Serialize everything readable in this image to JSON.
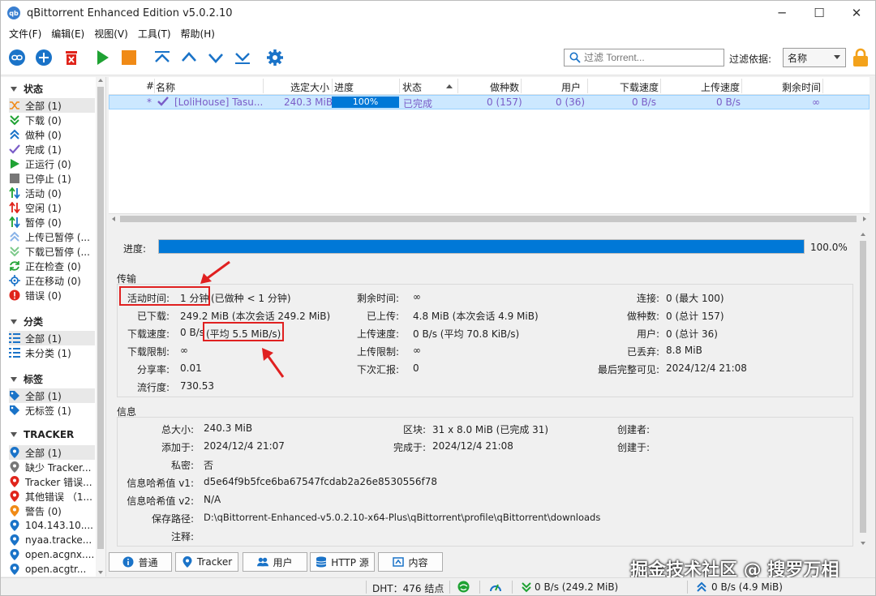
{
  "window": {
    "title": "qBittorrent Enhanced Edition v5.0.2.10",
    "app_icon_text": "qb"
  },
  "menu": [
    "文件(F)",
    "编辑(E)",
    "视图(V)",
    "工具(T)",
    "帮助(H)"
  ],
  "search": {
    "placeholder": "过滤 Torrent..."
  },
  "filter": {
    "label": "过滤依据:",
    "value": "名称"
  },
  "sidebar": {
    "status_header": "状态",
    "status_items": [
      {
        "label": "全部 (1)",
        "icon": "shuffle-icon"
      },
      {
        "label": "下载 (0)",
        "icon": "download-icon"
      },
      {
        "label": "做种 (0)",
        "icon": "seed-icon"
      },
      {
        "label": "完成 (1)",
        "icon": "check-icon"
      },
      {
        "label": "正运行 (0)",
        "icon": "play-icon"
      },
      {
        "label": "已停止 (1)",
        "icon": "stop-icon"
      },
      {
        "label": "活动 (0)",
        "icon": "active-icon"
      },
      {
        "label": "空闲 (1)",
        "icon": "idle-icon"
      },
      {
        "label": "暂停 (0)",
        "icon": "pause-icon"
      },
      {
        "label": "上传已暂停 (...",
        "icon": "upload-paused-icon"
      },
      {
        "label": "下载已暂停 (...",
        "icon": "download-paused-icon"
      },
      {
        "label": "正在检查 (0)",
        "icon": "checking-icon"
      },
      {
        "label": "正在移动 (0)",
        "icon": "moving-icon"
      },
      {
        "label": "错误 (0)",
        "icon": "error-icon"
      }
    ],
    "category_header": "分类",
    "category_items": [
      "全部 (1)",
      "未分类 (1)"
    ],
    "tag_header": "标签",
    "tag_items": [
      "全部 (1)",
      "无标签 (1)"
    ],
    "tracker_header": "TRACKER",
    "tracker_items": [
      {
        "label": "全部 (1)",
        "color": "#1a73c8"
      },
      {
        "label": "缺少 Tracker...",
        "color": "#777777"
      },
      {
        "label": "Tracker 错误...",
        "color": "#e0241b"
      },
      {
        "label": "其他错误 （1...",
        "color": "#e0241b"
      },
      {
        "label": "警告 (0)",
        "color": "#f08a16"
      },
      {
        "label": "104.143.10....",
        "color": "#1a73c8"
      },
      {
        "label": "nyaa.tracke...",
        "color": "#1a73c8"
      },
      {
        "label": "open.acgnx....",
        "color": "#1a73c8"
      },
      {
        "label": "open.acgtr...",
        "color": "#1a73c8"
      }
    ]
  },
  "table": {
    "headers": [
      "#",
      "名称",
      "选定大小",
      "进度",
      "状态",
      "做种数",
      "用户",
      "下载速度",
      "上传速度",
      "剩余时间"
    ],
    "row": {
      "num": "*",
      "name": "[LoliHouse] Tasu...",
      "size": "240.3 MiB",
      "progress": "100%",
      "progress_value": 1.0,
      "status": "已完成",
      "seeds": "0 (157)",
      "peers": "0 (36)",
      "down": "0 B/s",
      "up": "0 B/s",
      "eta": "∞"
    }
  },
  "details": {
    "progress_label": "进度:",
    "progress_value": "100.0%",
    "progress_fraction": 1.0,
    "transfer_title": "传输",
    "transfer": {
      "active_time_label": "活动时间:",
      "active_time": "1 分钟",
      "active_time_extra": "(已做种 < 1 分钟)",
      "downloaded_label": "已下载:",
      "downloaded": "249.2 MiB (本次会话 249.2 MiB)",
      "dl_speed_label": "下载速度:",
      "dl_speed": "0 B/s",
      "dl_speed_avg": "(平均 5.5 MiB/s)",
      "dl_limit_label": "下载限制:",
      "dl_limit": "∞",
      "ratio_label": "分享率:",
      "ratio": "0.01",
      "popularity_label": "流行度:",
      "popularity": "730.53",
      "eta_label": "剩余时间:",
      "eta": "∞",
      "uploaded_label": "已上传:",
      "uploaded": "4.8 MiB (本次会话 4.9 MiB)",
      "ul_speed_label": "上传速度:",
      "ul_speed": "0 B/s (平均 70.8 KiB/s)",
      "ul_limit_label": "上传限制:",
      "ul_limit": "∞",
      "reannounce_label": "下次汇报:",
      "reannounce": "0",
      "connections_label": "连接:",
      "connections": "0 (最大 100)",
      "seeds_label": "做种数:",
      "seeds": "0 (总计 157)",
      "peers_label": "用户:",
      "peers": "0 (总计 36)",
      "wasted_label": "已丢弃:",
      "wasted": "8.8 MiB",
      "last_complete_label": "最后完整可见:",
      "last_complete": "2024/12/4 21:08"
    },
    "info_title": "信息",
    "info": {
      "total_size_label": "总大小:",
      "total_size": "240.3 MiB",
      "added_on_label": "添加于:",
      "added_on": "2024/12/4 21:07",
      "private_label": "私密:",
      "private": "否",
      "hash_v1_label": "信息哈希值 v1:",
      "hash_v1": "d5e64f9b5fce6ba67547fcdab2a26e8530556f78",
      "hash_v2_label": "信息哈希值 v2:",
      "hash_v2": "N/A",
      "save_path_label": "保存路径:",
      "save_path": "D:\\qBittorrent-Enhanced-v5.0.2.10-x64-Plus\\qBittorrent\\profile\\qBittorrent\\downloads",
      "comment_label": "注释:",
      "comment": "",
      "pieces_label": "区块:",
      "pieces": "31 x 8.0 MiB (已完成 31)",
      "completed_on_label": "完成于:",
      "completed_on": "2024/12/4 21:08",
      "created_by_label": "创建者:",
      "created_by": "",
      "created_on_label": "创建于:",
      "created_on": ""
    }
  },
  "tabs": [
    "普通",
    "Tracker",
    "用户",
    "HTTP 源",
    "内容"
  ],
  "statusbar": {
    "dht": "DHT：476 结点",
    "down": "0 B/s (249.2 MiB)",
    "up": "0 B/s (4.9 MiB)"
  },
  "watermark": "掘金技术社区 @ 搜罗万相",
  "colors": {
    "accent": "#0078d7",
    "selection": "#cce8ff",
    "completed_text": "#7a5cc7",
    "highlight_box": "#e02020"
  }
}
